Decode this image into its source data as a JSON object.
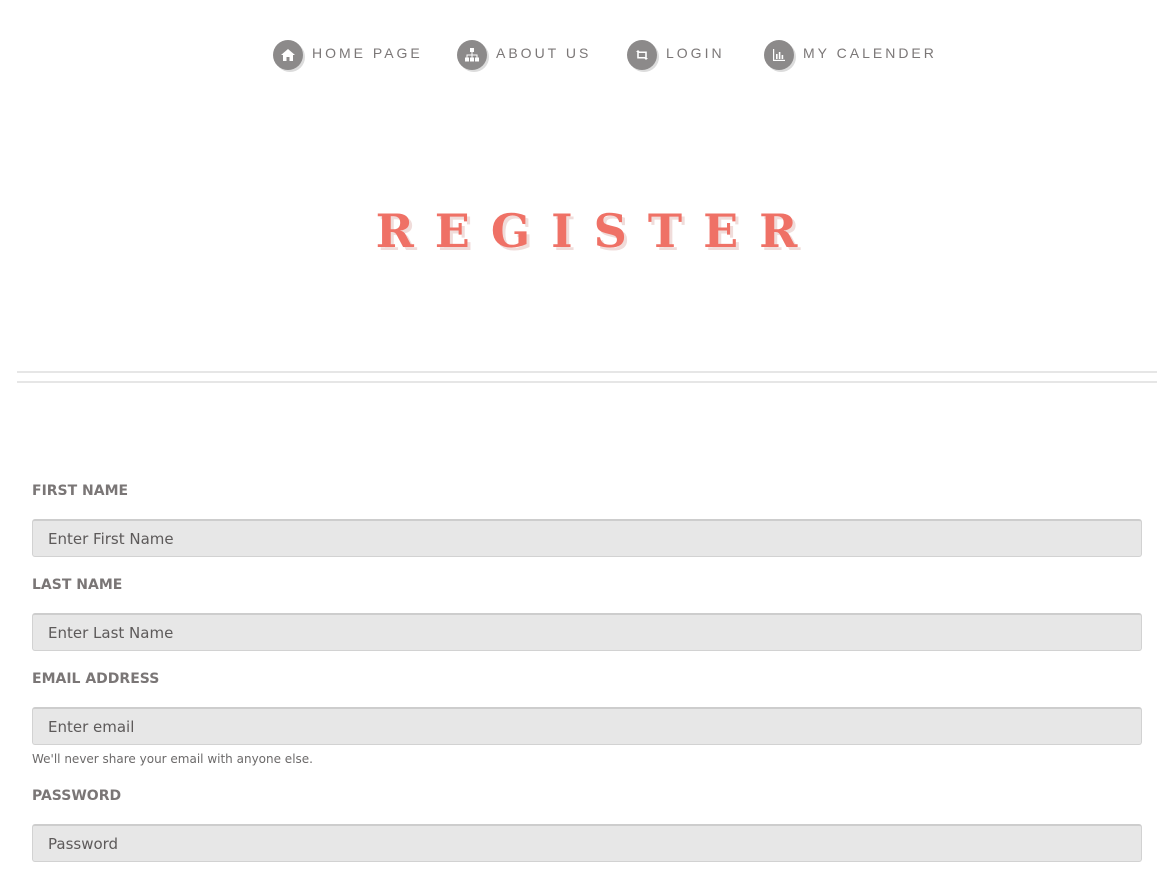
{
  "nav": {
    "items": [
      {
        "label": "HOME PAGE",
        "icon": "home-icon"
      },
      {
        "label": "ABOUT US",
        "icon": "sitemap-icon"
      },
      {
        "label": "LOGIN",
        "icon": "retweet-icon"
      },
      {
        "label": "MY CALENDER",
        "icon": "bar-chart-icon"
      }
    ],
    "icon_bg_color": "#8c8a8a"
  },
  "page": {
    "title": "REGISTER",
    "title_color": "#ef7166"
  },
  "form": {
    "first_name": {
      "label": "FIRST NAME",
      "placeholder": "Enter First Name"
    },
    "last_name": {
      "label": "LAST NAME",
      "placeholder": "Enter Last Name"
    },
    "email": {
      "label": "EMAIL ADDRESS",
      "placeholder": "Enter email",
      "help": "We'll never share your email with anyone else."
    },
    "password": {
      "label": "PASSWORD",
      "placeholder": "Password"
    }
  }
}
